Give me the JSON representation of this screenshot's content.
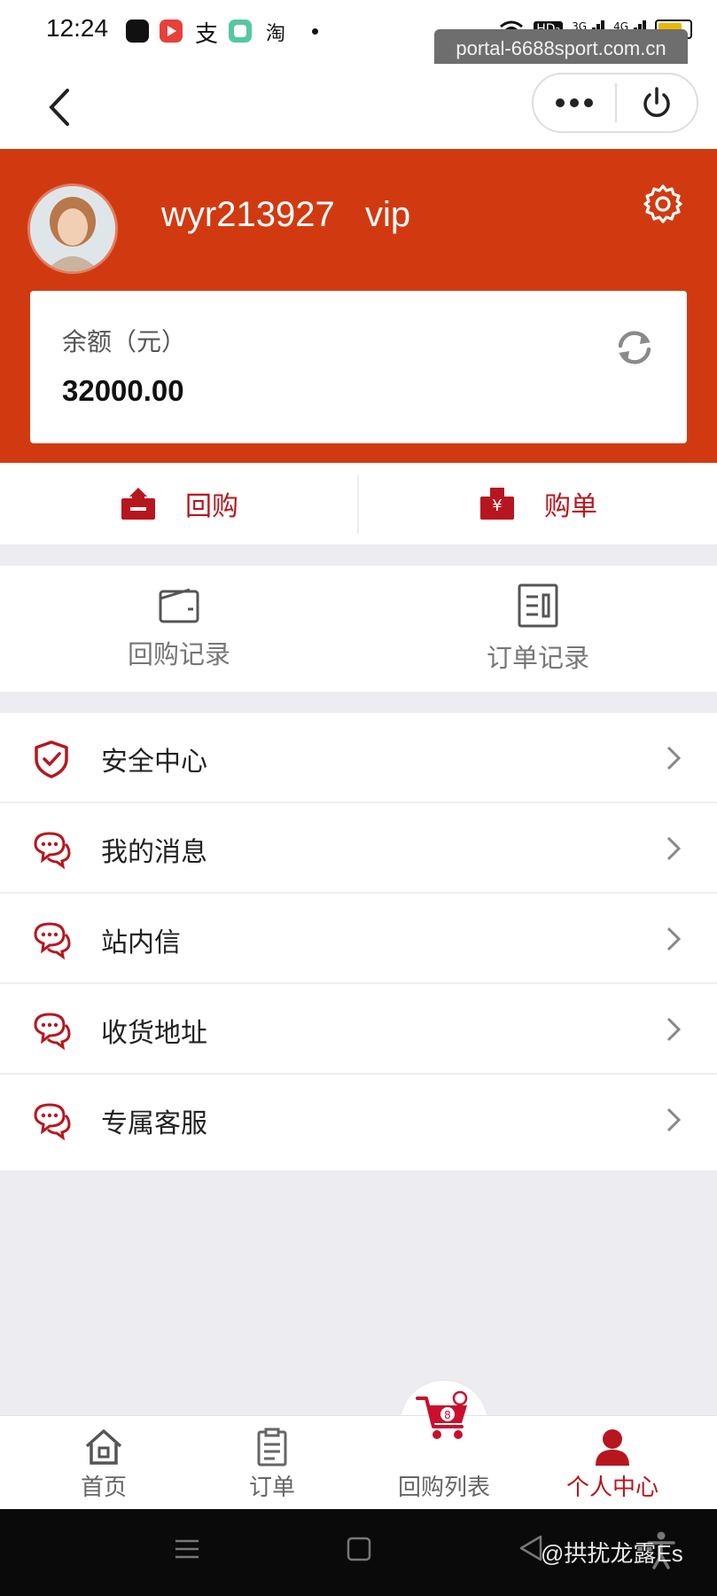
{
  "status_bar": {
    "time": "12:24",
    "app_icons": [
      "tiktok-icon",
      "play-app-icon",
      "alipay-icon",
      "green-app-icon",
      "taobao-icon"
    ],
    "indicators": [
      "wifi-icon",
      "hd-icon",
      "signal-3g-icon",
      "signal-4g-icon",
      "battery-icon"
    ],
    "hd_label": "HD₂",
    "net1": "3G",
    "net2": "4G"
  },
  "url_chip": "portal-6688sport.com.cn",
  "profile": {
    "username": "wyr213927",
    "vip": "vip",
    "balance_label": "余额（元）",
    "balance_value": "32000.00"
  },
  "actions": [
    {
      "label": "回购",
      "icon": "upload-box-icon"
    },
    {
      "label": "购单",
      "icon": "yen-download-icon"
    }
  ],
  "records": [
    {
      "label": "回购记录",
      "icon": "wallet-icon"
    },
    {
      "label": "订单记录",
      "icon": "document-list-icon"
    }
  ],
  "menu": [
    {
      "label": "安全中心",
      "icon": "shield-check-icon"
    },
    {
      "label": "我的消息",
      "icon": "chat-bubbles-icon"
    },
    {
      "label": "站内信",
      "icon": "chat-bubbles-icon"
    },
    {
      "label": "收货地址",
      "icon": "chat-bubbles-icon"
    },
    {
      "label": "专属客服",
      "icon": "chat-bubbles-icon"
    }
  ],
  "tabs": [
    {
      "label": "首页",
      "icon": "home-icon",
      "active": false
    },
    {
      "label": "订单",
      "icon": "clipboard-icon",
      "active": false
    },
    {
      "label": "回购列表",
      "icon": "cart-icon",
      "active": false
    },
    {
      "label": "个人中心",
      "icon": "person-icon",
      "active": true
    }
  ],
  "watermark": "@拱扰龙露Es",
  "colors": {
    "header_red": "#d13a10",
    "accent_red": "#b8161e",
    "page_bg": "#ececf1"
  }
}
